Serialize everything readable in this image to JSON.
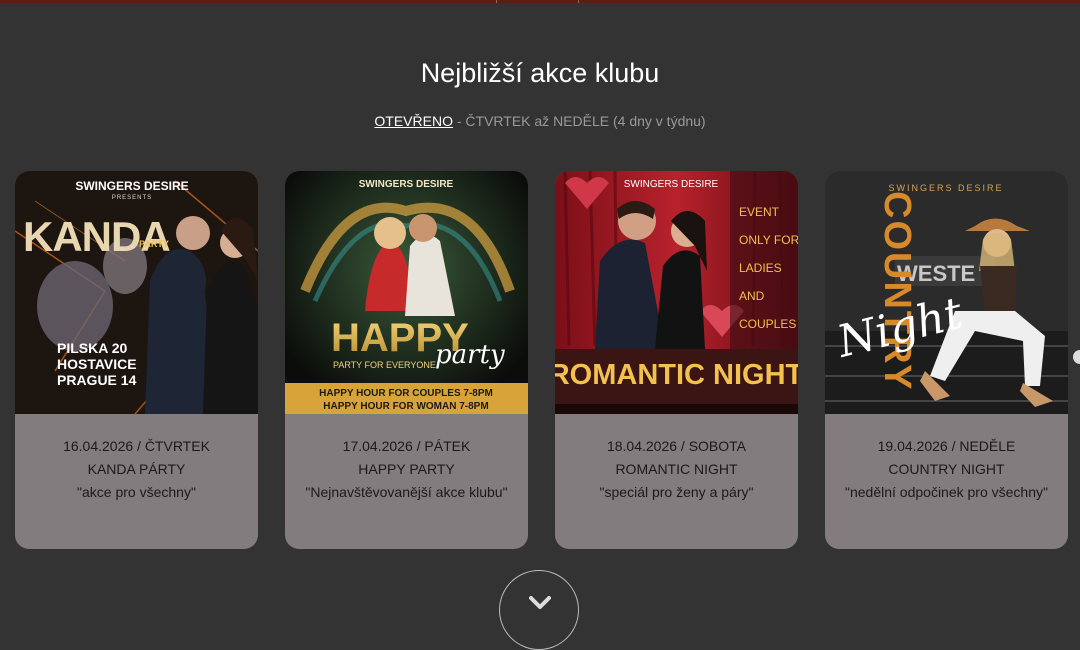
{
  "section": {
    "title": "Nejbližší akce klubu",
    "open_link": "OTEVŘENO",
    "open_rest": " - ČTVRTEK až NEDĚLE (4 dny v týdnu)"
  },
  "events": [
    {
      "date_line": "16.04.2026 / ČTVRTEK",
      "name": "KANDA PÁRTY",
      "tagline": "\"akce pro všechny\"",
      "poster": {
        "brand": "SWINGERS DESIRE",
        "brand_sub": "PRESENTS",
        "title": "KANDA",
        "title_sub": "PARTY",
        "address_1": "PILSKA 20",
        "address_2": "HOSTAVICE",
        "address_3": "PRAGUE 14"
      }
    },
    {
      "date_line": "17.04.2026 / PÁTEK",
      "name": "HAPPY PARTY",
      "tagline": "\"Nejnavštěvovanější akce klubu\"",
      "poster": {
        "brand": "SWINGERS DESIRE",
        "title": "HAPPY",
        "title_script": "party",
        "subtitle": "PARTY FOR EVERYONE",
        "hh_1": "HAPPY HOUR FOR COUPLES 7-8PM",
        "hh_2": "HAPPY HOUR FOR WOMAN 7-8PM"
      }
    },
    {
      "date_line": "18.04.2026 / SOBOTA",
      "name": "ROMANTIC NIGHT",
      "tagline": "\"speciál pro ženy a páry\"",
      "poster": {
        "brand": "SWINGERS DESIRE",
        "side_1": "EVENT",
        "side_2": "ONLY FOR",
        "side_3": "LADIES",
        "side_4": "AND",
        "side_5": "COUPLES",
        "title": "ROMANTIC NIGHT"
      }
    },
    {
      "date_line": "19.04.2026 / NEDĚLE",
      "name": "COUNTRY NIGHT",
      "tagline": "\"nedělní odpočinek pro všechny\"",
      "poster": {
        "brand": "SWINGERS DESIRE",
        "title": "COUNTRY",
        "title_script": "Night",
        "sign": "WESTE"
      }
    }
  ],
  "colors": {
    "page_bg": "#333333",
    "card_bg": "#837c7f",
    "accent_gold": "#f2c14e",
    "accent_red": "#c0272d"
  },
  "icons": {
    "scroll": "chevron-down-icon",
    "carousel": "next-slide-dot"
  }
}
